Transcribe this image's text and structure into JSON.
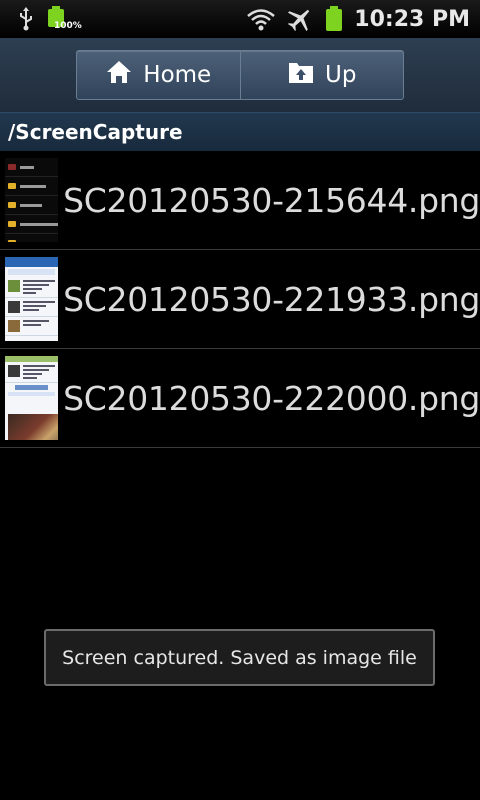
{
  "status_bar": {
    "battery_percent": "100%",
    "time": "10:23 PM",
    "icons": [
      "usb-icon",
      "battery-full-icon",
      "wifi-icon",
      "airplane-mode-icon",
      "battery-charging-icon"
    ],
    "battery_color": "#7ed321"
  },
  "toolbar": {
    "home_label": "Home",
    "up_label": "Up"
  },
  "path": "/ScreenCapture",
  "files": [
    {
      "name": "SC20120530-215644.png"
    },
    {
      "name": "SC20120530-221933.png"
    },
    {
      "name": "SC20120530-222000.png"
    }
  ],
  "toast": "Screen captured. Saved as image file",
  "colors": {
    "toolbar_bg": "#2a3a4c",
    "path_bg": "#1e3247",
    "list_text": "#dcdcdc"
  }
}
